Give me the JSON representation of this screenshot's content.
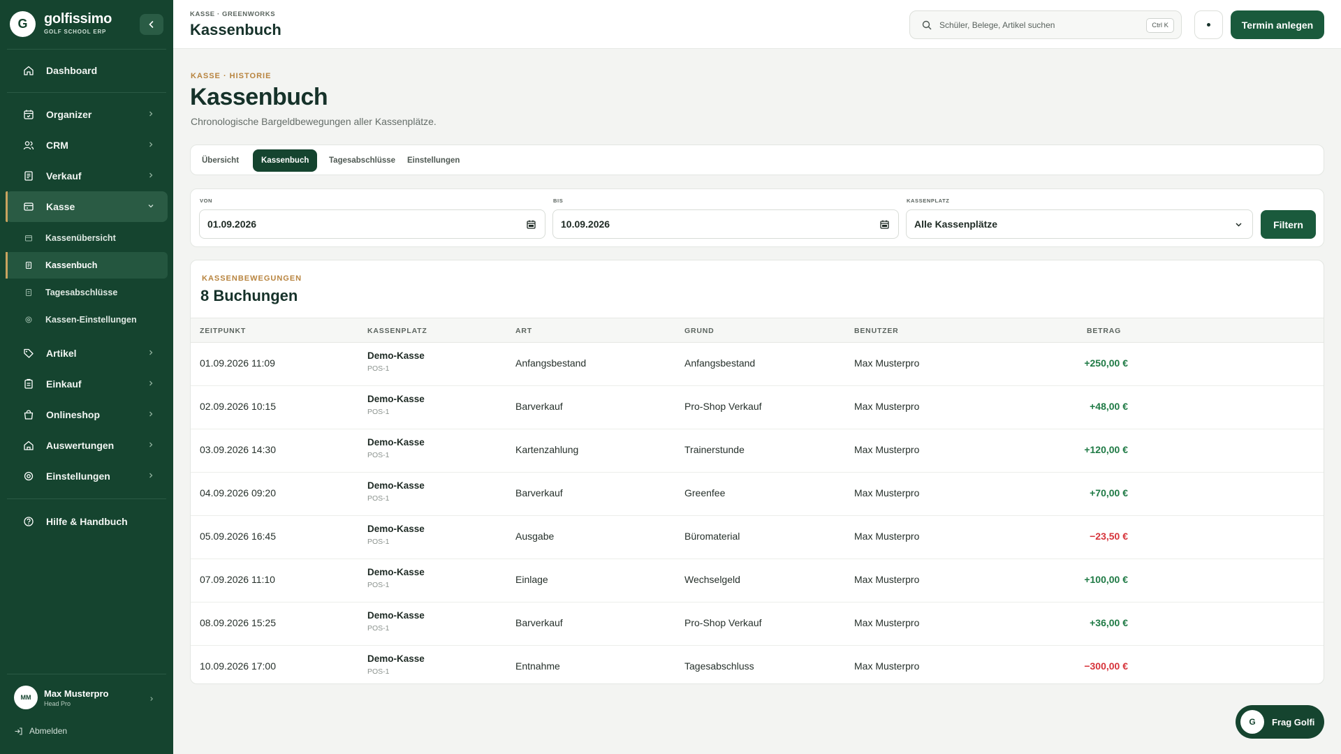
{
  "brand": {
    "logo_letter": "G",
    "name": "golfissimo",
    "tagline": "GOLF SCHOOL ERP"
  },
  "sidebar": {
    "items": [
      {
        "label": "Dashboard",
        "icon": "home-icon"
      },
      {
        "label": "Organizer",
        "icon": "calendar-icon"
      },
      {
        "label": "CRM",
        "icon": "users-icon"
      },
      {
        "label": "Verkauf",
        "icon": "receipt-icon"
      },
      {
        "label": "Kasse",
        "icon": "cash-register-icon"
      },
      {
        "label": "Artikel",
        "icon": "tag-icon"
      },
      {
        "label": "Einkauf",
        "icon": "clipboard-icon"
      },
      {
        "label": "Onlineshop",
        "icon": "shopping-bag-icon"
      },
      {
        "label": "Auswertungen",
        "icon": "chart-home-icon"
      },
      {
        "label": "Einstellungen",
        "icon": "gear-icon"
      },
      {
        "label": "Hilfe & Handbuch",
        "icon": "help-icon"
      }
    ],
    "kasse_sub": [
      {
        "label": "Kassenübersicht"
      },
      {
        "label": "Kassenbuch"
      },
      {
        "label": "Tagesabschlüsse"
      },
      {
        "label": "Kassen-Einstellungen"
      }
    ],
    "user": {
      "initials": "MM",
      "name": "Max Musterpro",
      "role": "Head Pro"
    },
    "logout": "Abmelden"
  },
  "topbar": {
    "breadcrumb": "KASSE · GREENWORKS",
    "title": "Kassenbuch",
    "search_placeholder": "Schüler, Belege, Artikel suchen",
    "search_shortcut": "Ctrl K",
    "primary_action": "Termin anlegen"
  },
  "page": {
    "eyebrow": "KASSE · HISTORIE",
    "title": "Kassenbuch",
    "subtitle": "Chronologische Bargeldbewegungen aller Kassenplätze."
  },
  "tabs": [
    {
      "label": "Übersicht"
    },
    {
      "label": "Kassenbuch"
    },
    {
      "label": "Tagesabschlüsse"
    },
    {
      "label": "Einstellungen"
    }
  ],
  "filters": {
    "from_label": "VON",
    "from_value": "01.09.2026",
    "to_label": "BIS",
    "to_value": "10.09.2026",
    "register_label": "KASSENPLATZ",
    "register_value": "Alle Kassenplätze",
    "submit": "Filtern"
  },
  "table": {
    "eyebrow": "KASSENBEWEGUNGEN",
    "title": "8 Buchungen",
    "columns": [
      "ZEITPUNKT",
      "KASSENPLATZ",
      "ART",
      "GRUND",
      "BENUTZER",
      "BETRAG"
    ],
    "rows": [
      {
        "time": "01.09.2026 11:09",
        "register": "Demo-Kasse",
        "pos": "POS-1",
        "type": "Anfangsbestand",
        "reason": "Anfangsbestand",
        "user": "Max Musterpro",
        "amount": "+250,00 €",
        "sign": "pos"
      },
      {
        "time": "02.09.2026 10:15",
        "register": "Demo-Kasse",
        "pos": "POS-1",
        "type": "Barverkauf",
        "reason": "Pro-Shop Verkauf",
        "user": "Max Musterpro",
        "amount": "+48,00 €",
        "sign": "pos"
      },
      {
        "time": "03.09.2026 14:30",
        "register": "Demo-Kasse",
        "pos": "POS-1",
        "type": "Kartenzahlung",
        "reason": "Trainerstunde",
        "user": "Max Musterpro",
        "amount": "+120,00 €",
        "sign": "pos"
      },
      {
        "time": "04.09.2026 09:20",
        "register": "Demo-Kasse",
        "pos": "POS-1",
        "type": "Barverkauf",
        "reason": "Greenfee",
        "user": "Max Musterpro",
        "amount": "+70,00 €",
        "sign": "pos"
      },
      {
        "time": "05.09.2026 16:45",
        "register": "Demo-Kasse",
        "pos": "POS-1",
        "type": "Ausgabe",
        "reason": "Büromaterial",
        "user": "Max Musterpro",
        "amount": "−23,50 €",
        "sign": "neg"
      },
      {
        "time": "07.09.2026 11:10",
        "register": "Demo-Kasse",
        "pos": "POS-1",
        "type": "Einlage",
        "reason": "Wechselgeld",
        "user": "Max Musterpro",
        "amount": "+100,00 €",
        "sign": "pos"
      },
      {
        "time": "08.09.2026 15:25",
        "register": "Demo-Kasse",
        "pos": "POS-1",
        "type": "Barverkauf",
        "reason": "Pro-Shop Verkauf",
        "user": "Max Musterpro",
        "amount": "+36,00 €",
        "sign": "pos"
      },
      {
        "time": "10.09.2026 17:00",
        "register": "Demo-Kasse",
        "pos": "POS-1",
        "type": "Entnahme",
        "reason": "Tagesabschluss",
        "user": "Max Musterpro",
        "amount": "−300,00 €",
        "sign": "neg"
      }
    ]
  },
  "assistant": {
    "logo_letter": "G",
    "label": "Frag Golfi"
  },
  "colors": {
    "sidebar": "#15442f",
    "accent": "#1a5a3c",
    "gold": "#b8843f",
    "positive": "#1f7a45",
    "negative": "#d6333a"
  }
}
